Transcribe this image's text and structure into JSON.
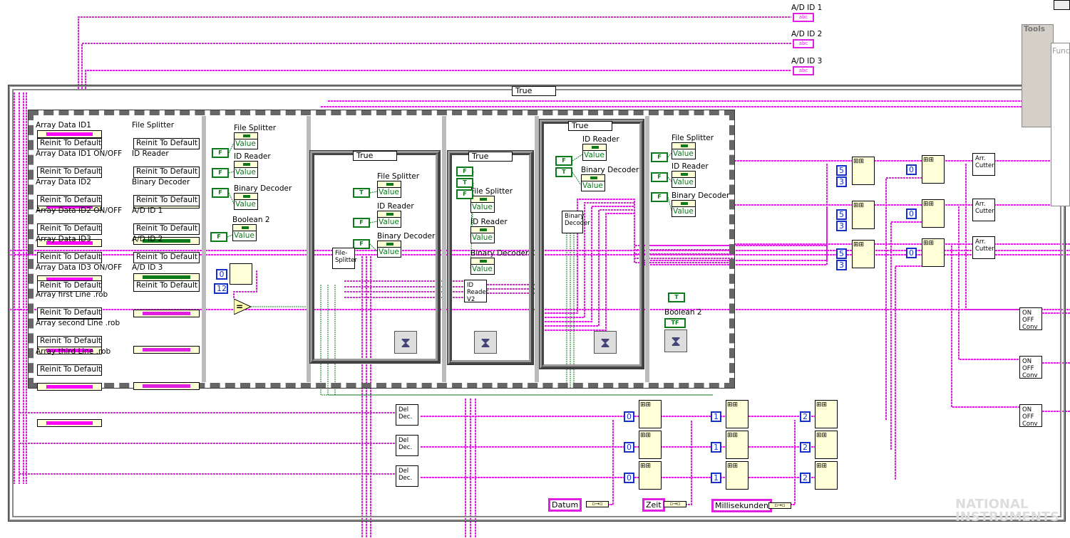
{
  "indicators_top": [
    {
      "label": "A/D  ID 1",
      "glyph": "abc"
    },
    {
      "label": "A/D  ID 2",
      "glyph": "abc"
    },
    {
      "label": "A/D  ID 3",
      "glyph": "abc"
    }
  ],
  "loop": {
    "case_selector": "True"
  },
  "frame1": {
    "left_controls": [
      {
        "label": "Array Data ID1",
        "button": "Reinit To Default"
      },
      {
        "label": "Array Data ID1 ON/OFF",
        "button": "Reinit To Default"
      },
      {
        "label": "Array Data ID2",
        "button": "Reinit To Default"
      },
      {
        "label": "Array Data ID2 ON/OFF",
        "button": "Reinit To Default"
      },
      {
        "label": "Array Data ID3",
        "button": "Reinit To Default"
      },
      {
        "label": "Array Data ID3 ON/OFF",
        "button": "Reinit To Default"
      },
      {
        "label": "Array first Line .rob",
        "button": "Reinit To Default"
      },
      {
        "label": "Array second Line .rob",
        "button": "Reinit To Default"
      },
      {
        "label": "Array third Line .rob",
        "button": "Reinit To Default"
      }
    ],
    "right_controls": [
      {
        "label": "File Splitter",
        "button": "Reinit To Default",
        "color": "#0a7a1a"
      },
      {
        "label": "ID Reader",
        "button": "Reinit To Default",
        "color": "#0a7a1a"
      },
      {
        "label": "Binary Decoder",
        "button": "Reinit To Default",
        "color": "#0a7a1a"
      },
      {
        "label": "A/D  ID 1",
        "button": "Reinit To Default",
        "color": "#e020e0"
      },
      {
        "label": "A/D  ID 2",
        "button": "Reinit To Default",
        "color": "#e020e0"
      },
      {
        "label": "A/D  ID 3",
        "button": "Reinit To Default",
        "color": "#e020e0"
      }
    ]
  },
  "frame2": {
    "items": [
      {
        "label": "File Splitter",
        "value": "Value",
        "const": "F"
      },
      {
        "label": "ID Reader",
        "value": "Value",
        "const": "F"
      },
      {
        "label": "Binary Decoder",
        "value": "Value",
        "const": "F"
      },
      {
        "label": "Boolean 2",
        "value": "Value",
        "const": "F"
      }
    ],
    "start_const": "0",
    "length_const": "12",
    "compare": "="
  },
  "case1": {
    "selector": "True",
    "items": [
      {
        "label": "File Splitter",
        "value": "Value",
        "const": "T"
      },
      {
        "label": "ID Reader",
        "value": "Value",
        "const": "F"
      },
      {
        "label": "Binary Decoder",
        "value": "Value",
        "const": "F"
      }
    ],
    "subvi": "File-Splitter"
  },
  "case2": {
    "selector": "True",
    "items": [
      {
        "label": "File Splitter",
        "value": "Value",
        "const": "F"
      },
      {
        "label": "ID Reader",
        "value": "Value",
        "const": "T"
      },
      {
        "label": "Binary Decoder",
        "value": "Value",
        "const": "F"
      }
    ],
    "subvi": "ID Reader V2"
  },
  "case3": {
    "selector": "True",
    "items": [
      {
        "label": "ID Reader",
        "value": "Value",
        "const": "F"
      },
      {
        "label": "Binary Decoder",
        "value": "Value",
        "const": "T"
      }
    ],
    "subvi": "Binary Decoder"
  },
  "frame6": {
    "items": [
      {
        "label": "File Splitter",
        "value": "Value",
        "const": "F"
      },
      {
        "label": "ID Reader",
        "value": "Value",
        "const": "F"
      },
      {
        "label": "Binary Decoder",
        "value": "Value",
        "const": "F"
      }
    ],
    "boolean": {
      "label": "Boolean 2",
      "const": "T",
      "value": "TF"
    }
  },
  "right_section": {
    "subset_consts": [
      "5",
      "3"
    ],
    "index_const": "0",
    "cutter": "Arr. Cutter",
    "converter": "ON OFF Conv"
  },
  "bottom_section": {
    "del_dec": "Del Dec.",
    "index_consts": [
      "0",
      "1",
      "2"
    ],
    "strings": [
      "Datum",
      "Zeit",
      "Millisekunden"
    ]
  },
  "palettes": {
    "tools": "Tools",
    "functions": "Func"
  },
  "watermark": "NATIONAL INSTRUMENTS",
  "colors": {
    "string_wire": "#e020e0",
    "bool_wire": "#0a7a1a",
    "numeric": "#1430c8",
    "node": "#ffffd8"
  }
}
